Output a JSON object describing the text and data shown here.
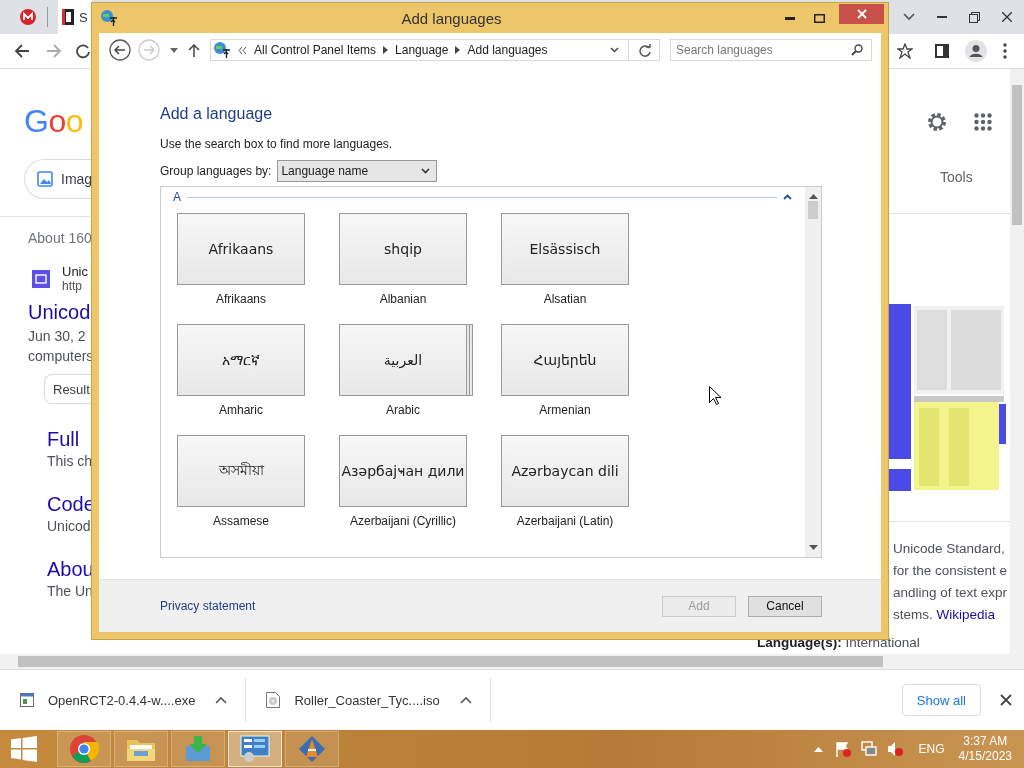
{
  "browser": {
    "tabs": [
      {
        "label": "S",
        "selected": true
      }
    ],
    "google": {
      "logo": "Goo",
      "images_chip": "Imag",
      "tools": "Tools"
    },
    "results_count": "About 160",
    "top_result": {
      "site": "Unic",
      "url": "http",
      "title": "Unicod",
      "snippet": [
        "Jun 30, 2",
        "computers"
      ],
      "chip": "Result"
    },
    "sublinks": [
      {
        "title": "Full",
        "snippet": "This ch"
      },
      {
        "title": "Code",
        "snippet": "Unicod"
      },
      {
        "title": "Abou",
        "snippet": "The Un"
      }
    ],
    "knowledge_panel": {
      "picture": {
        "kind": "picture"
      },
      "lines": [
        "Unicode Standard,",
        "for the consistent e",
        "andling of text expr",
        "stems."
      ],
      "link": "Wikipedia",
      "fact": "**Language(s):** International"
    },
    "downloads": [
      {
        "name": "OpenRCT2-0.4.4-w....exe",
        "kind": "exe"
      },
      {
        "name": "Roller_Coaster_Tyc....iso",
        "kind": "iso"
      }
    ],
    "show_all": "Show all"
  },
  "dialog": {
    "title": "Add languages",
    "breadcrumb": [
      "All Control Panel Items",
      "Language",
      "Add languages"
    ],
    "search_placeholder": "Search languages",
    "heading": "Add a language",
    "hint": "Use the search box to find more languages.",
    "group_by_label": "Group languages by:",
    "group_by_value": "Language name",
    "group_letter": "A",
    "languages": [
      {
        "native": "Afrikaans",
        "name": "Afrikaans",
        "stacked": false
      },
      {
        "native": "shqip",
        "name": "Albanian",
        "stacked": false
      },
      {
        "native": "Elsässisch",
        "name": "Alsatian",
        "stacked": false
      },
      {
        "native": "አማርኛ",
        "name": "Amharic",
        "stacked": false
      },
      {
        "native": "العربية",
        "name": "Arabic",
        "stacked": true
      },
      {
        "native": "Հայերեն",
        "name": "Armenian",
        "stacked": false
      },
      {
        "native": "অসমীয়া",
        "name": "Assamese",
        "stacked": false
      },
      {
        "native": "Азәрбајҹан дили",
        "name": "Azerbaijani (Cyrillic)",
        "stacked": false
      },
      {
        "native": "Azərbaycan dili",
        "name": "Azerbaijani (Latin)",
        "stacked": false
      }
    ],
    "privacy": "Privacy statement",
    "buttons": [
      {
        "label": "Add",
        "disabled": true
      },
      {
        "label": "Cancel",
        "disabled": false
      }
    ]
  },
  "taskbar": {
    "apps": [
      {
        "kind": "chrome",
        "active": false
      },
      {
        "kind": "folder",
        "active": false
      },
      {
        "kind": "download",
        "active": false
      },
      {
        "kind": "control-panel",
        "active": true
      },
      {
        "kind": "installer",
        "active": false
      }
    ],
    "language": "ENG",
    "time": "3:37 AM",
    "date": "4/15/2023"
  }
}
